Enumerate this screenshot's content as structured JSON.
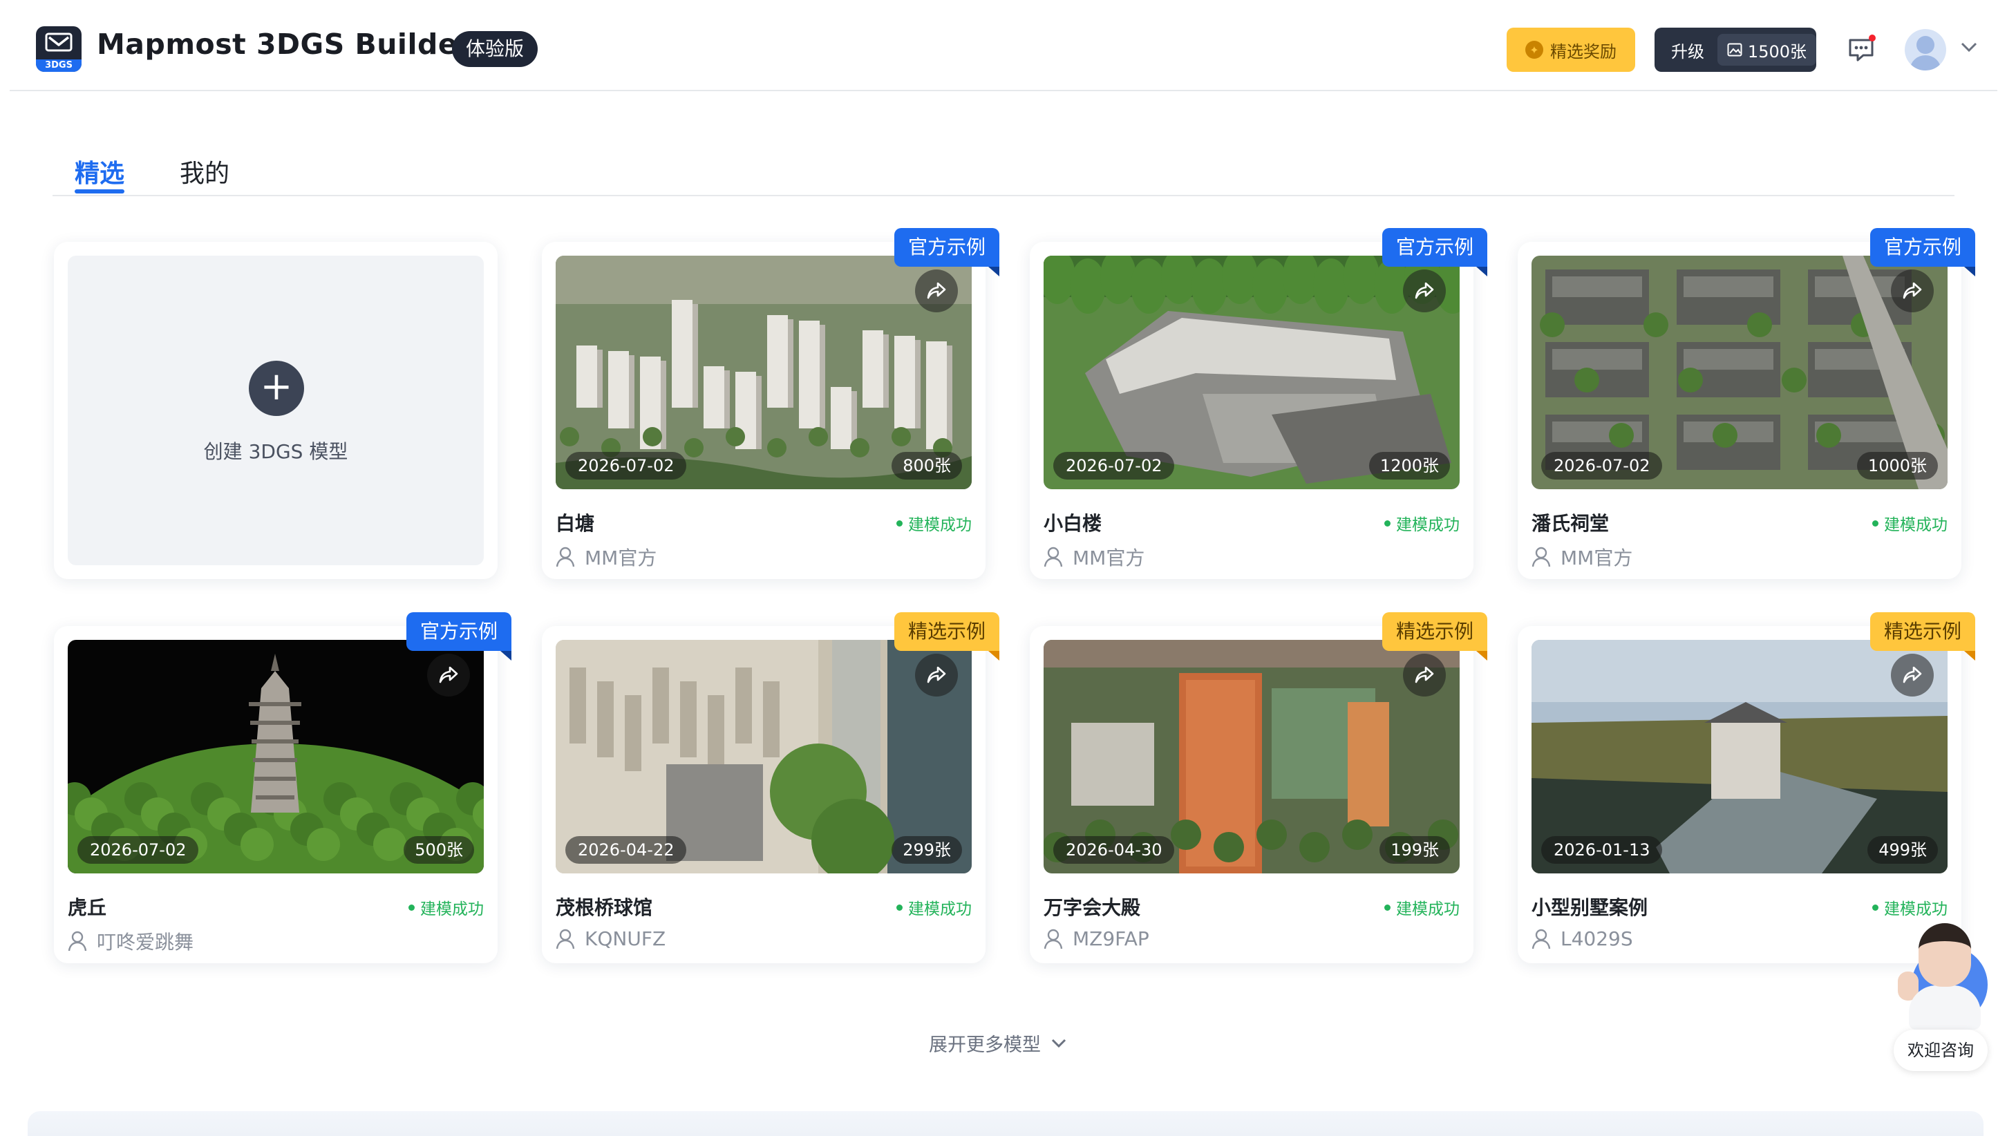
{
  "header": {
    "logo_sub": "3DGS",
    "app_title": "Mapmost 3DGS Builder",
    "edition_badge": "体验版",
    "reward_label": "精选奖励",
    "upgrade_label": "升级",
    "quota": "1500张",
    "icons": {
      "reward": "badge-icon",
      "quota": "image-icon",
      "message": "message-icon",
      "avatar": "user-avatar",
      "user_menu": "chevron-down-icon"
    }
  },
  "tabs": [
    {
      "label": "精选",
      "active": true
    },
    {
      "label": "我的",
      "active": false
    }
  ],
  "create_card": {
    "label": "创建 3DGS 模型"
  },
  "cards": [
    {
      "title": "白塘",
      "status": "建模成功",
      "author": "MM官方",
      "date": "2026-07-02",
      "count": "800张",
      "tag": "官方示例",
      "tag_type": "official",
      "scene": "city"
    },
    {
      "title": "小白楼",
      "status": "建模成功",
      "author": "MM官方",
      "date": "2026-07-02",
      "count": "1200张",
      "tag": "官方示例",
      "tag_type": "official",
      "scene": "building"
    },
    {
      "title": "潘氏祠堂",
      "status": "建模成功",
      "author": "MM官方",
      "date": "2026-07-02",
      "count": "1000张",
      "tag": "官方示例",
      "tag_type": "official",
      "scene": "village"
    },
    {
      "title": "虎丘",
      "status": "建模成功",
      "author": "叮咚爱跳舞",
      "date": "2026-07-02",
      "count": "500张",
      "tag": "官方示例",
      "tag_type": "official",
      "scene": "pagoda"
    },
    {
      "title": "茂根桥球馆",
      "status": "建模成功",
      "author": "KQNUFZ",
      "date": "2026-04-22",
      "count": "299张",
      "tag": "精选示例",
      "tag_type": "featured",
      "scene": "construction"
    },
    {
      "title": "万字会大殿",
      "status": "建模成功",
      "author": "MZ9FAP",
      "date": "2026-04-30",
      "count": "199张",
      "tag": "精选示例",
      "tag_type": "featured",
      "scene": "temple"
    },
    {
      "title": "小型别墅案例",
      "status": "建模成功",
      "author": "L4029S",
      "date": "2026-01-13",
      "count": "499张",
      "tag": "精选示例",
      "tag_type": "featured",
      "scene": "villa"
    }
  ],
  "more_label": "展开更多模型",
  "assistant_label": "欢迎咨询",
  "colors": {
    "accent": "#1e6cf0",
    "official_tag": "#1e6cf0",
    "featured_tag": "#ffc63d",
    "success": "#23b35a",
    "dark": "#1f2636"
  }
}
